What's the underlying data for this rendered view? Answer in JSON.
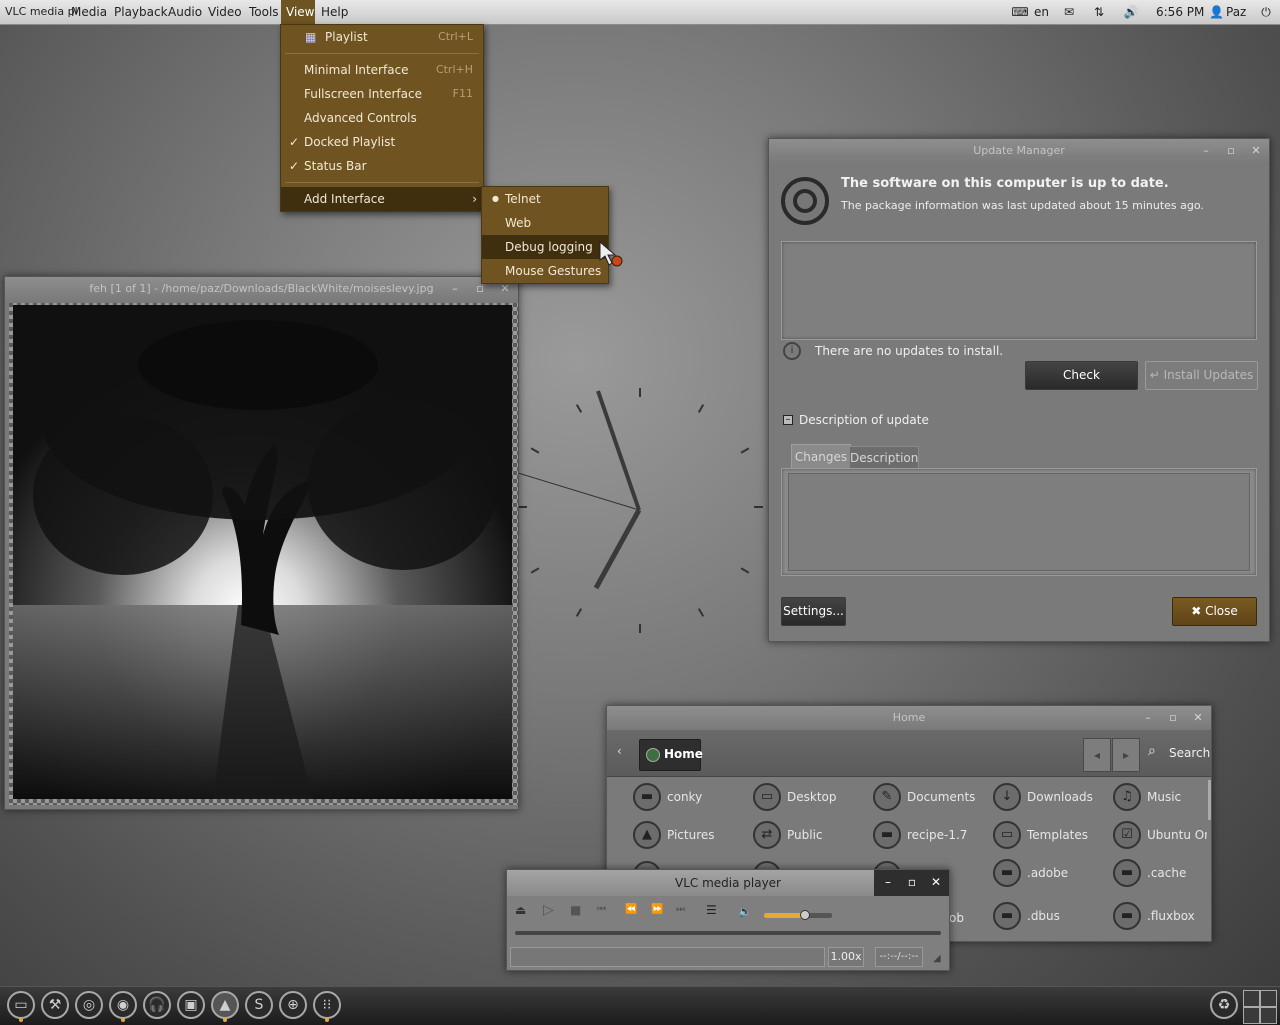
{
  "topbar": {
    "app_name": "VLC media pl",
    "menus": [
      "Media",
      "Playback",
      "Audio",
      "Video",
      "Tools",
      "View",
      "Help"
    ],
    "lang": "en",
    "time": "6:56 PM",
    "user": "Paz"
  },
  "view_menu": {
    "playlist": {
      "label": "Playlist",
      "shortcut": "Ctrl+L"
    },
    "minimal": {
      "label": "Minimal Interface",
      "shortcut": "Ctrl+H"
    },
    "fullscreen": {
      "label": "Fullscreen Interface",
      "shortcut": "F11"
    },
    "advanced": {
      "label": "Advanced Controls"
    },
    "docked": {
      "label": "Docked Playlist",
      "checked": true
    },
    "statusbar": {
      "label": "Status Bar",
      "checked": true
    },
    "add_interface": {
      "label": "Add Interface"
    }
  },
  "submenu": {
    "telnet": "Telnet",
    "web": "Web",
    "debug": "Debug logging",
    "gestures": "Mouse Gestures"
  },
  "feh": {
    "title": "feh [1 of 1] - /home/paz/Downloads/BlackWhite/moiseslevy.jpg"
  },
  "update_manager": {
    "title": "Update Manager",
    "headline": "The software on this computer is up to date.",
    "subline": "The package information was last updated about 15 minutes ago.",
    "status": "There are no updates to install.",
    "check_label": "Check",
    "install_label": "Install Updates",
    "description_label": "Description of update",
    "tabs": [
      "Changes",
      "Description"
    ],
    "settings_label": "Settings...",
    "close_label": "Close"
  },
  "file_manager": {
    "title": "Home",
    "location": "Home",
    "search_label": "Search",
    "items": [
      {
        "name": "conky",
        "icon": "folder-icon"
      },
      {
        "name": "Desktop",
        "icon": "desktop-icon"
      },
      {
        "name": "Documents",
        "icon": "documents-icon"
      },
      {
        "name": "Downloads",
        "icon": "download-icon"
      },
      {
        "name": "Music",
        "icon": "music-icon"
      },
      {
        "name": "Pictures",
        "icon": "pictures-icon"
      },
      {
        "name": "Public",
        "icon": "public-icon"
      },
      {
        "name": "recipe-1.7",
        "icon": "folder-icon"
      },
      {
        "name": "Templates",
        "icon": "templates-icon"
      },
      {
        "name": "Ubuntu One",
        "icon": "ubuntu-one-icon"
      },
      {
        "name": ".adobe",
        "icon": "folder-icon"
      },
      {
        "name": ".cache",
        "icon": "folder-icon"
      },
      {
        "name": ".dbus",
        "icon": "folder-icon"
      },
      {
        "name": ".fluxbox",
        "icon": "folder-icon"
      }
    ],
    "hidden_partial": "ob"
  },
  "vlc": {
    "title": "VLC media player",
    "speed": "1.00x",
    "time": "--:--/--:--",
    "volume": 0.6
  },
  "colors": {
    "menu_bg": "#6f5421",
    "menu_highlight": "#3f2f0f",
    "accent": "#e7a83a"
  }
}
